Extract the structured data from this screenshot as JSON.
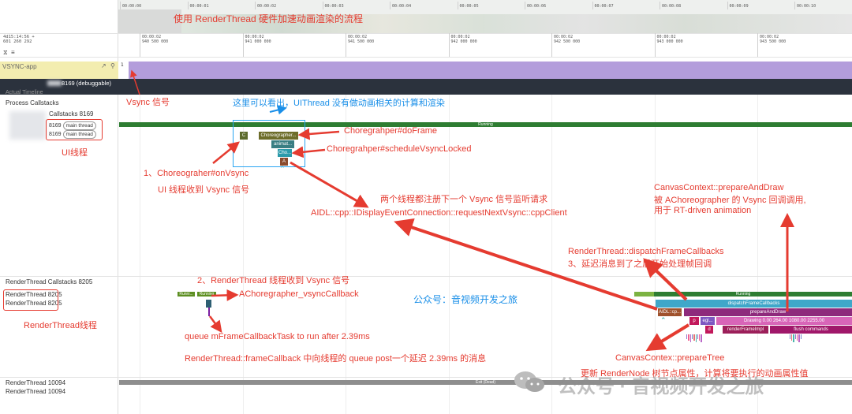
{
  "overview": {
    "ticks": [
      "00:00:00",
      "00:00:01",
      "00:00:02",
      "00:00:03",
      "00:00:04",
      "00:00:05",
      "00:00:06",
      "00:00:07",
      "00:00:08",
      "00:00:09",
      "00:00:10"
    ]
  },
  "header": {
    "ts_line1": "4d15:14:56 +",
    "ts_line2": "601 260 292",
    "ticks": [
      {
        "t1": "00:00:02",
        "t2": "940 500 000"
      },
      {
        "t1": "00:00:02",
        "t2": "941 000 000"
      },
      {
        "t1": "00:00:02",
        "t2": "941 500 000"
      },
      {
        "t1": "00:00:02",
        "t2": "942 000 000"
      },
      {
        "t1": "00:00:02",
        "t2": "942 500 000"
      },
      {
        "t1": "00:00:02",
        "t2": "943 000 000"
      },
      {
        "t1": "00:00:02",
        "t2": "943 500 000"
      }
    ]
  },
  "tracks": {
    "vsync_app": "VSYNC-app",
    "vsync_val": "1",
    "process_pid": "8169",
    "debuggable": "debuggable",
    "actual_timeline": "Actual Timeline",
    "process_callstacks": "Process Callstacks",
    "callstacks_8169": "Callstacks 8169",
    "main_pid1": "8169",
    "main_thread1": "main thread",
    "main_pid2": "8169",
    "main_thread2": "main thread",
    "rt_callstacks": "RenderThread Callstacks 8205",
    "rt_1": "RenderThread 8205",
    "rt_2": "RenderThread 8205",
    "rt_10094_a": "RenderThread 10094",
    "rt_10094_b": "RenderThread 10094"
  },
  "slices": {
    "running_main": "Running",
    "c": "C",
    "choreographer": "Choreographer...",
    "animat": "animat...",
    "cho": "Cho...",
    "a": "A",
    "runn1": "Runni...",
    "runn2": "Running",
    "running_rt": "Running",
    "dispatch": "dispatchFrameCallbacks",
    "prepare": "prepareAndDraw",
    "aidl": "AIDL::cp...",
    "p": "p",
    "egl": "egl...",
    "drawing": "Drawing  0.00 264.00 1080.00 2255.00",
    "render_frame": "renderFrameImpl",
    "flush": "flush commands",
    "d": "d",
    "exit_dead": "Exit (Dead)"
  },
  "annotations": {
    "title": "使用 RenderThread 硬件加速动画渲染的流程",
    "vsync_signal": "Vsync 信号",
    "ui_no_anim": "这里可以看出，UIThread 没有做动画相关的计算和渲染",
    "do_frame": "Choregrahper#doFrame",
    "schedule_vsync": "Choregrahper#scheduleVsyncLocked",
    "ui_thread": "UI线程",
    "on_vsync": "1、Choreograher#onVsync",
    "ui_recv_vsync": "UI 线程收到 Vsync 信号",
    "both_register": "两个线程都注册下一个 Vsync 信号监听请求",
    "aidl_request": "AIDL::cpp::IDisplayEventConnection::requestNextVsync::cppClient",
    "ctx_prepare_draw": "CanvasContext::prepareAndDraw",
    "called_by": "被 AChoreographer 的 Vsync 回调调用,",
    "rt_driven": "用于 RT-driven animation",
    "rt_dispatch": "RenderThread::dispatchFrameCallbacks",
    "delay_msg": "3、延迟消息到了之后开始处理帧回调",
    "rt_recv": "2、RenderThread 线程收到 Vsync 信号",
    "vsync_callback": "AChoregrapher_vsyncCallback",
    "wechat": "公众号：音视频开发之旅",
    "rt_label": "RenderThread线程",
    "queue_task": "queue mFrameCallbackTask to run after 2.39ms",
    "frame_callback": "RenderThread::frameCallback 中向线程的 queue post一个延迟 2.39ms 的消息",
    "prepare_tree": "CanvasContex::prepareTree",
    "update_node": "更新 RenderNode 树节点属性，计算将要执行的动画属性值",
    "watermark": "公众号 · 音视频开发之旅"
  },
  "colors": {
    "vsync_purple": "#b39ddb",
    "running_green": "#2e7d32",
    "dispatch_blue": "#3fa7c9",
    "prepare_purple": "#8e2a7c",
    "drawing_pink": "#d865b8",
    "annotation_red": "#e53b30",
    "annotation_blue": "#1a8fe8"
  }
}
